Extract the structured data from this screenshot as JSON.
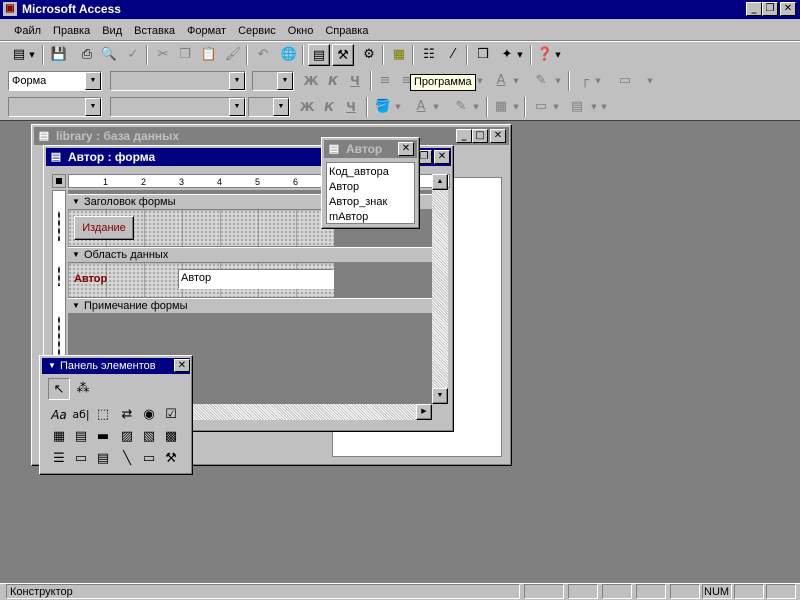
{
  "app": {
    "title": "Microsoft Access"
  },
  "menu": [
    "Файл",
    "Правка",
    "Вид",
    "Вставка",
    "Формат",
    "Сервис",
    "Окно",
    "Справка"
  ],
  "format_bar": {
    "object_combo": "Форма",
    "tooltip": "Программа"
  },
  "bold_label": "Ж",
  "italic_label": "К",
  "underline_label": "Ч",
  "db_window": {
    "title": "library : база данных"
  },
  "form_window": {
    "title": "Автор : форма"
  },
  "ruler": [
    "1",
    "2",
    "3",
    "4",
    "5",
    "6"
  ],
  "sections": {
    "header": "Заголовок формы",
    "detail": "Область данных",
    "footer": "Примечание формы"
  },
  "controls": {
    "button_label": "Издание",
    "field_label": "Автор",
    "field_value": "Автор"
  },
  "field_list": {
    "title": "Автор",
    "items": [
      "Код_автора",
      "Автор",
      "Автор_знак",
      "mАвтор"
    ]
  },
  "toolbox": {
    "title": "Панель элементов"
  },
  "status": {
    "mode": "Конструктор",
    "num": "NUM"
  },
  "colors": {
    "titlebar_active": "#000080",
    "titlebar_inactive": "#808080",
    "workspace": "#808080",
    "label_text": "#800000"
  },
  "icons": [
    "view-icon",
    "save-icon",
    "print-icon",
    "print-preview-icon",
    "spelling-icon",
    "cut-icon",
    "copy-icon",
    "paste-icon",
    "format-painter-icon",
    "undo-icon",
    "hyperlink-icon",
    "field-list-icon",
    "toolbox-icon",
    "autoformat-icon",
    "code-icon",
    "properties-icon",
    "build-icon",
    "database-window-icon",
    "new-object-icon",
    "help-icon"
  ]
}
